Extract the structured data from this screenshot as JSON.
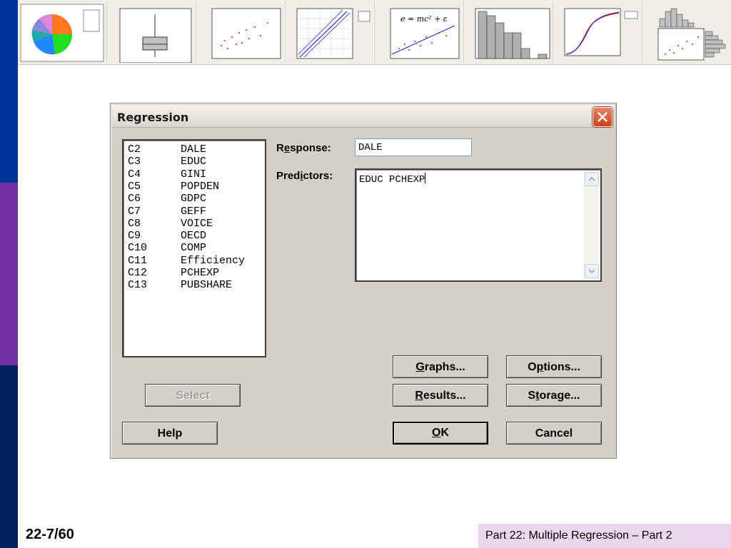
{
  "colors": {
    "sidebar_top": "#003399",
    "sidebar_mid": "#7030a0",
    "sidebar_bottom": "#002060",
    "dialog_bg": "#d4d0c8",
    "close_red": "#c8421e",
    "footer_bg": "#ead8ee"
  },
  "dialog": {
    "title": "Regression",
    "variables": [
      {
        "col": "C2",
        "name": "DALE"
      },
      {
        "col": "C3",
        "name": "EDUC"
      },
      {
        "col": "C4",
        "name": "GINI"
      },
      {
        "col": "C5",
        "name": "POPDEN"
      },
      {
        "col": "C6",
        "name": "GDPC"
      },
      {
        "col": "C7",
        "name": "GEFF"
      },
      {
        "col": "C8",
        "name": "VOICE"
      },
      {
        "col": "C9",
        "name": "OECD"
      },
      {
        "col": "C10",
        "name": "COMP"
      },
      {
        "col": "C11",
        "name": "Efficiency"
      },
      {
        "col": "C12",
        "name": "PCHEXP"
      },
      {
        "col": "C13",
        "name": "PUBSHARE"
      }
    ],
    "response_label": {
      "pre": "R",
      "key": "e",
      "post": "sponse:"
    },
    "response_value": "DALE",
    "predictors_label": {
      "pre": "Pred",
      "key": "i",
      "post": "ctors:"
    },
    "predictors_value": "EDUC PCHEXP",
    "buttons": {
      "select": "Select",
      "help": "Help",
      "graphs": {
        "key": "G",
        "post": "raphs..."
      },
      "options": {
        "pre": "O",
        "key": "p",
        "post": "tions..."
      },
      "results": {
        "key": "R",
        "post": "esults..."
      },
      "storage": {
        "pre": "S",
        "key": "t",
        "post": "orage..."
      },
      "ok": {
        "key": "O",
        "post": "K"
      },
      "cancel": "Cancel"
    }
  },
  "footer": {
    "page": "22-7/60",
    "section": "Part 22: Multiple Regression – Part 2"
  },
  "thumbnails": [
    {
      "icon": "pie-chart"
    },
    {
      "icon": "boxplot"
    },
    {
      "icon": "scatterplot"
    },
    {
      "icon": "probability-plot"
    },
    {
      "icon": "scatterplot-with-formula",
      "formula": "e = mc² + ε"
    },
    {
      "icon": "histogram"
    },
    {
      "icon": "cdf-plot"
    },
    {
      "icon": "marginal-plot"
    }
  ]
}
